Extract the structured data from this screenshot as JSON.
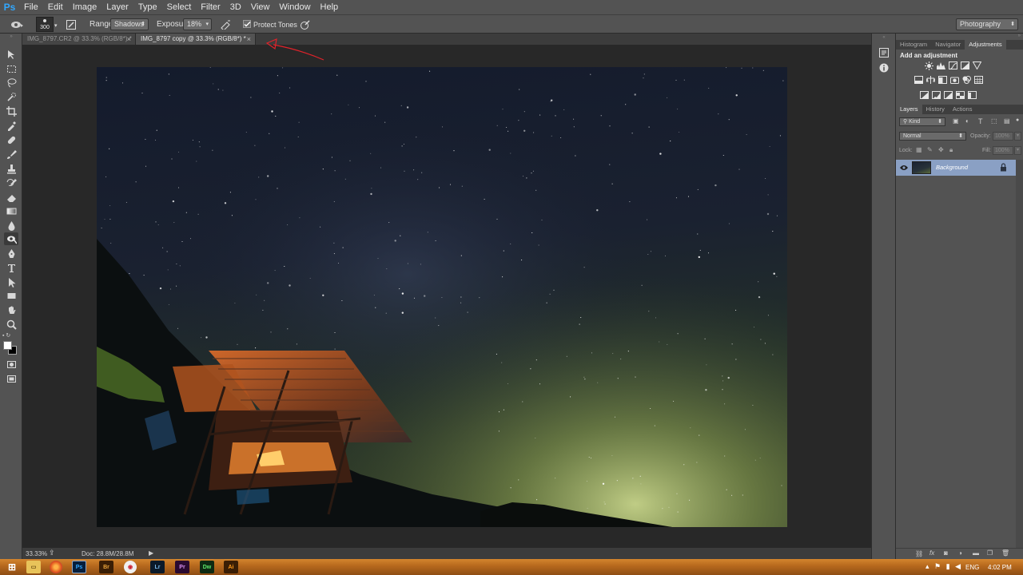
{
  "app": {
    "logo": "Ps",
    "workspace": "Photography"
  },
  "menu": [
    "File",
    "Edit",
    "Image",
    "Layer",
    "Type",
    "Select",
    "Filter",
    "3D",
    "View",
    "Window",
    "Help"
  ],
  "options": {
    "brush_size": "300",
    "range_label": "Range:",
    "range_value": "Shadows",
    "exposure_label": "Exposure:",
    "exposure_value": "18%",
    "protect_tones_label": "Protect Tones",
    "protect_tones_checked": true
  },
  "doc_tabs": [
    {
      "label": "IMG_8797.CR2 @ 33.3% (RGB/8*) *",
      "active": false
    },
    {
      "label": "IMG_8797 copy @ 33.3% (RGB/8*) *",
      "active": true
    }
  ],
  "status": {
    "zoom": "33.33%",
    "doc": "Doc: 28.8M/28.8M"
  },
  "panels": {
    "top_tabs": [
      "Histogram",
      "Navigator",
      "Adjustments"
    ],
    "adjustments_title": "Add an adjustment",
    "layer_tabs": [
      "Layers",
      "History",
      "Actions"
    ],
    "filter_kind": "Kind",
    "blend_mode": "Normal",
    "opacity_label": "Opacity:",
    "opacity_value": "100%",
    "lock_label": "Lock:",
    "fill_label": "Fill:",
    "fill_value": "100%",
    "layers": [
      {
        "name": "Background",
        "visible": true,
        "locked": true
      }
    ]
  },
  "taskbar": {
    "apps": [
      "Br",
      "Lr",
      "Pr",
      "Dw",
      "Ai"
    ],
    "language": "ENG",
    "time": "4:02 PM"
  },
  "colors": {
    "accent": "#31a8ff",
    "panel": "#535353",
    "canvas": "#282828",
    "selected_layer": "#8aa0c4",
    "annotation": "#e0222a"
  }
}
